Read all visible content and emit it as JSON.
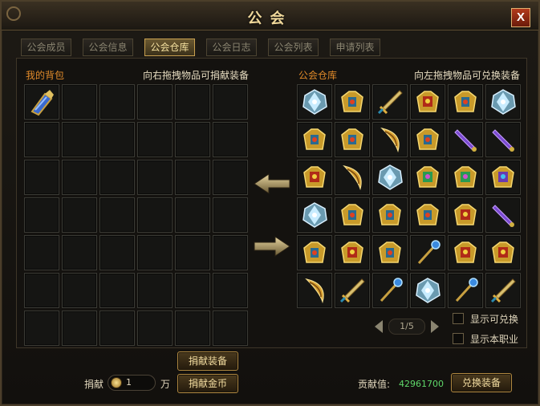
{
  "window": {
    "title": "公会",
    "close_label": "X"
  },
  "tabs": [
    {
      "label": "公会成员",
      "active": false
    },
    {
      "label": "公会信息",
      "active": false
    },
    {
      "label": "公会仓库",
      "active": true
    },
    {
      "label": "公会日志",
      "active": false
    },
    {
      "label": "公会列表",
      "active": false
    },
    {
      "label": "申请列表",
      "active": false
    }
  ],
  "backpack": {
    "title": "我的背包",
    "hint": "向右拖拽物品可捐献装备",
    "items": [
      "gauntlet-blue"
    ]
  },
  "warehouse": {
    "title": "公会仓库",
    "hint": "向左拖拽物品可兑换装备",
    "items": [
      "armor-crystal",
      "armor-gold",
      "sword-gold",
      "armor-gold-red",
      "armor-gold",
      "armor-crystal",
      "armor-gold",
      "armor-gold",
      "blade-crescent",
      "armor-gold",
      "dagger-purple",
      "dagger-purple",
      "armor-gold-red",
      "blade-crescent",
      "armor-crystal",
      "armor-gold-green",
      "armor-gold-green",
      "armor-gold-purple",
      "armor-crystal",
      "armor-gold",
      "armor-gold",
      "armor-gold",
      "armor-gold-red",
      "dagger-purple",
      "armor-gold",
      "armor-gold-red",
      "armor-gold",
      "staff-blue",
      "armor-gold-red",
      "armor-gold-red",
      "blade-crescent",
      "sword-gold",
      "staff-blue",
      "armor-crystal",
      "staff-blue",
      "sword-gold"
    ]
  },
  "pager": {
    "text": "1/5"
  },
  "options": {
    "show_exchangeable": "显示可兑换",
    "show_profession": "显示本职业"
  },
  "buttons": {
    "donate_equipment": "捐献装备",
    "donate_gold": "捐献金币",
    "exchange_equipment": "兑换装备"
  },
  "donate": {
    "label": "捐献",
    "amount": "1",
    "unit": "万"
  },
  "contribution": {
    "label": "贡献值:",
    "value": "42961700"
  },
  "colors": {
    "accent": "#e08a2a",
    "gold": "#f0d89a",
    "contribution": "#5fd86a"
  }
}
